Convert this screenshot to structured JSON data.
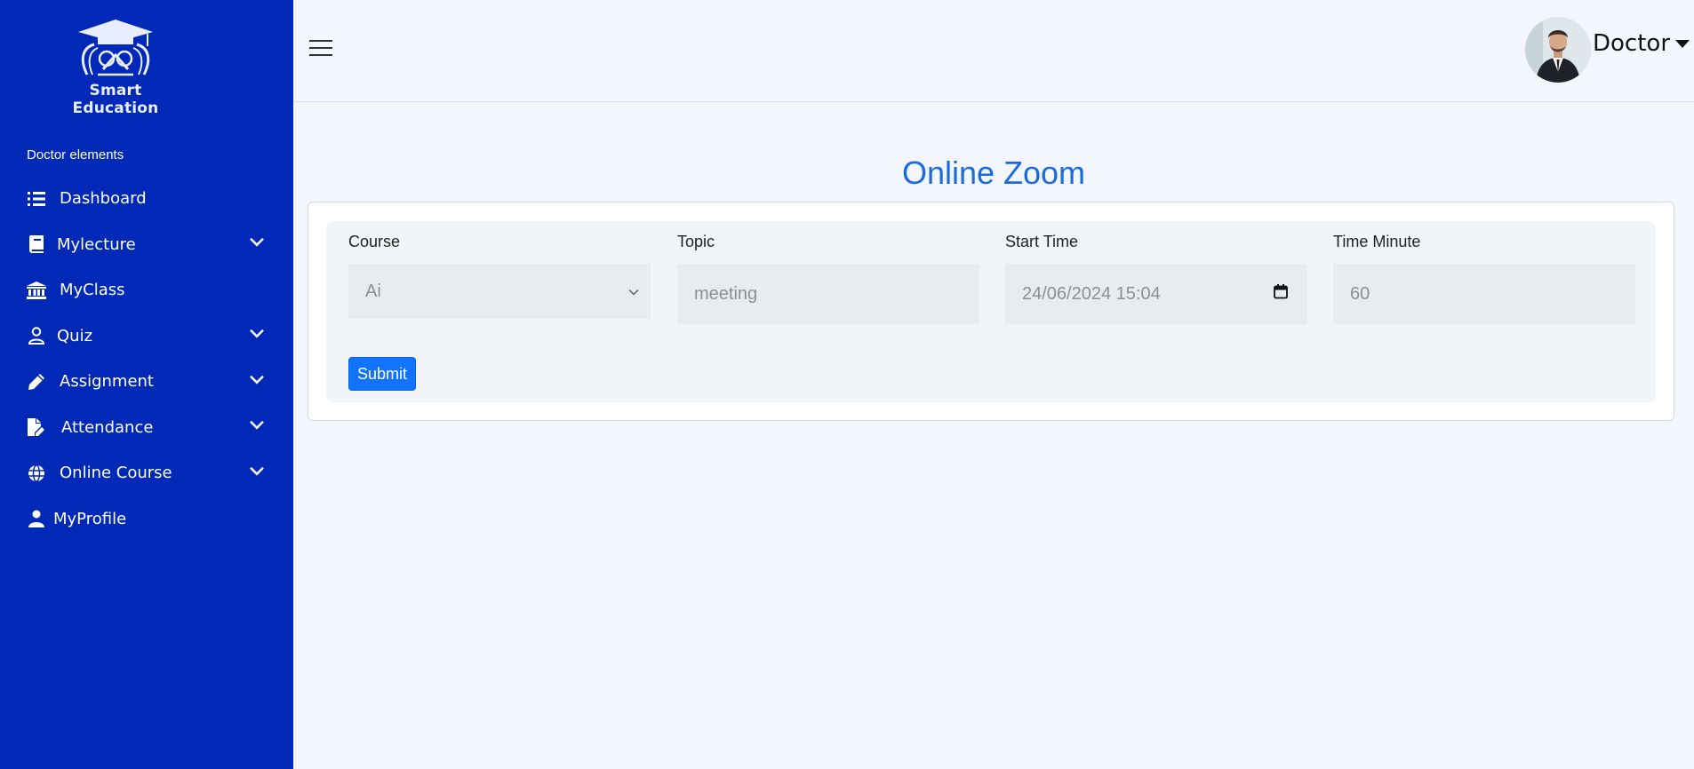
{
  "brand": {
    "name": "Smart Education"
  },
  "sidebar": {
    "section_title": "Doctor elements",
    "items": [
      {
        "label": "Dashboard",
        "icon": "list-icon",
        "expandable": false
      },
      {
        "label": "Mylecture",
        "icon": "book-icon",
        "expandable": true
      },
      {
        "label": "MyClass",
        "icon": "bank-icon",
        "expandable": false
      },
      {
        "label": "Quiz",
        "icon": "user-outline-icon",
        "expandable": true
      },
      {
        "label": "Assignment",
        "icon": "pencil-icon",
        "expandable": true
      },
      {
        "label": "Attendance",
        "icon": "file-edit-icon",
        "expandable": true
      },
      {
        "label": "Online Course",
        "icon": "globe-icon",
        "expandable": true
      },
      {
        "label": "MyProfile",
        "icon": "user-icon",
        "expandable": false
      }
    ]
  },
  "header": {
    "user_name": "Doctor"
  },
  "main": {
    "title": "Online Zoom",
    "form": {
      "course": {
        "label": "Course",
        "value": "Ai"
      },
      "topic": {
        "label": "Topic",
        "value": "meeting"
      },
      "start_time": {
        "label": "Start Time",
        "value": "24/06/2024 15:04"
      },
      "time_minute": {
        "label": "Time Minute",
        "value": "60"
      },
      "submit_label": "Submit"
    }
  },
  "colors": {
    "sidebar": "#0029b8",
    "accent": "#1a6ae0",
    "button": "#1273ff",
    "background": "#f3f6fc"
  }
}
